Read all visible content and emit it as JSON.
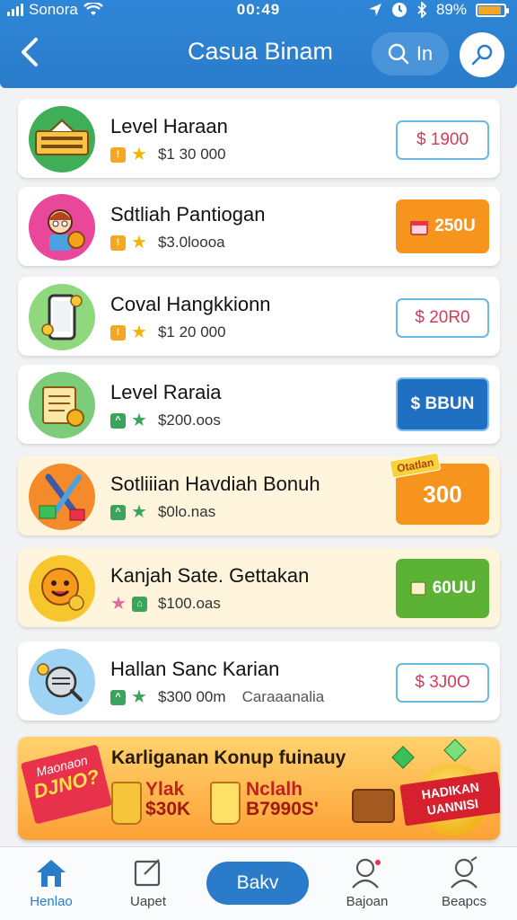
{
  "status": {
    "carrier": "Sonora",
    "time": "00:49",
    "battery": "89%",
    "battery_level": 0.89
  },
  "header": {
    "title": "Casua Binam",
    "search_label": "In"
  },
  "items": [
    {
      "name": "Level Haraan",
      "price": "$1 30 000",
      "button": "$ 1900",
      "button_style": "outline",
      "icon": "gift-banner-icon"
    },
    {
      "name": "Sdtliah Pantiogan",
      "price": "$3.0loooa",
      "button": "250U",
      "button_style": "orange",
      "icon": "girl-avatar-icon"
    },
    {
      "name": "Coval Hangkkionn",
      "price": "$1 20 000",
      "button": "$ 20R0",
      "button_style": "outline",
      "icon": "phone-icon"
    },
    {
      "name": "Level Raraia",
      "price": "$200.oos",
      "button": "$ BBUN",
      "button_style": "blue",
      "icon": "scroll-icon"
    },
    {
      "name": "Sotliiian Havdiah Bonuh",
      "price": "$0lo.nas",
      "button": "300",
      "button_small": "Otatlan",
      "button_style": "big300",
      "icon": "wrench-gift-icon"
    },
    {
      "name": "Kanjah Sate. Gettakan",
      "price": "$100.oas",
      "button": "60UU",
      "button_style": "green",
      "icon": "smiley-icon"
    },
    {
      "name": "Hallan Sanc Karian",
      "price": "$300 00m",
      "extra": "Caraaanalia",
      "button": "$ 3J0O",
      "button_style": "outline",
      "icon": "robot-icon"
    }
  ],
  "banner": {
    "title": "Karliganan Konup fuinauy",
    "ribbon_top": "Maonaon",
    "ribbon_bottom": "DJNO?",
    "offer1_line1": "Ylak",
    "offer1_line2": "$30K",
    "offer2_line1": "Nclalh",
    "offer2_line2": "B7990S'",
    "badge_line1": "HADIKAN",
    "badge_line2": "UANNISI"
  },
  "nav": [
    {
      "label": "Henlao",
      "icon": "home-icon"
    },
    {
      "label": "Uapet",
      "icon": "edit-icon"
    },
    {
      "label": "Bakv",
      "icon": ""
    },
    {
      "label": "Bajoan",
      "icon": "user-search-icon"
    },
    {
      "label": "Beapcs",
      "icon": "profile-icon"
    }
  ],
  "colors": {
    "primary": "#2a7ccb",
    "orange": "#f7941d",
    "green": "#5bb234",
    "price_red": "#d23c5a"
  }
}
